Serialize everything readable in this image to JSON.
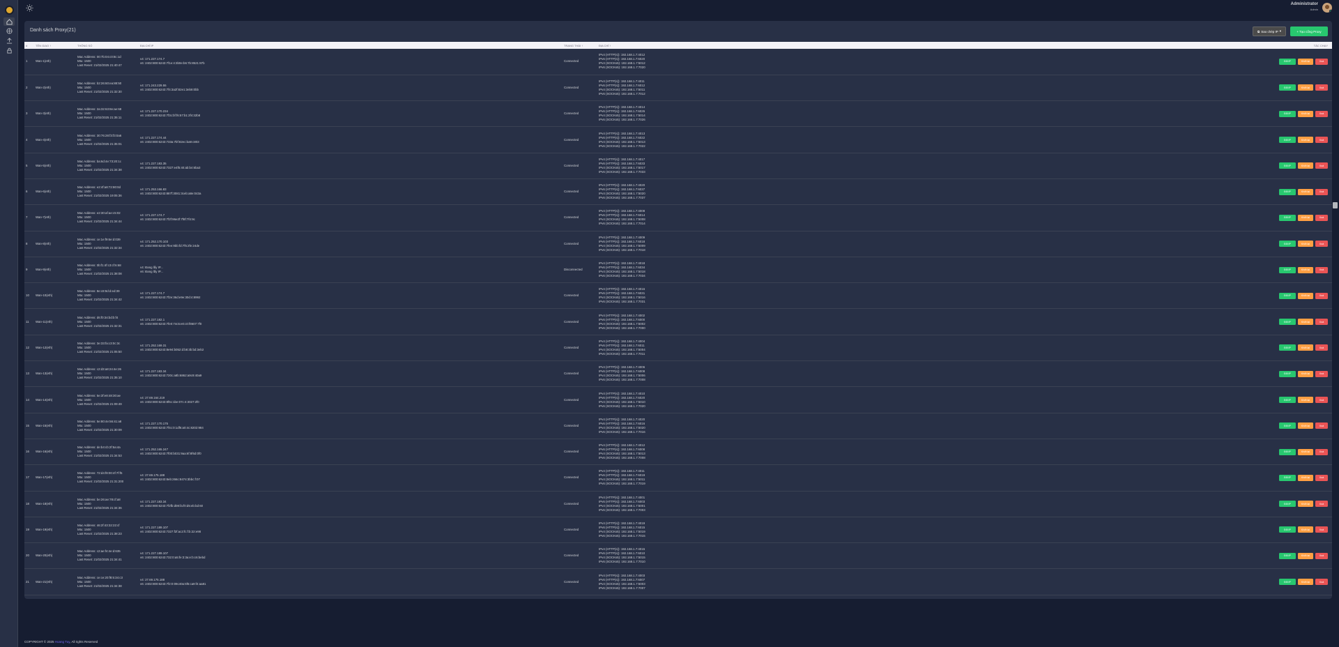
{
  "header": {
    "user_name": "Administrator",
    "user_role": "Admin"
  },
  "sidebar": {
    "items": [
      "home-icon",
      "globe-icon",
      "upload-icon",
      "lock-icon"
    ]
  },
  "card": {
    "title": "Danh sách Proxy(21)",
    "snapshot_label": "Sao chép IP",
    "create_label": "+ Tạo cổng Proxy"
  },
  "table": {
    "headers": [
      "#",
      "TÊN GIAO ↑",
      "THÔNG SỐ",
      "ĐỊA CHỈ IP",
      "TRẠNG THÁI ↑",
      "ĐỊA CHỈ ↑",
      "TÁC CHẠY"
    ],
    "action_labels": {
      "reset": "Đổi IP",
      "restart": "Khởi lại",
      "delete": "Xoá"
    },
    "rows": [
      {
        "no": "1",
        "name": "Wan-1(eth)",
        "mac": "Mac Address: 00:7b:04:c0:8c:1d",
        "mtu": "Mtu: 1500",
        "reset": "Last Reset: 21/02/2025 21:40:47",
        "v4": "v4: 171.227.174.7",
        "v6": "v6: 2402:800:6243:7f1e:4:3b0e:b6:7b:8521:87b",
        "status": "Connected",
        "p1": "IPv4 (HTTP(s)): 192.168.1.7:4012",
        "p2": "IPv6 (HTTP(s)): 192.168.1.7:6020",
        "p3": "IPv4 (SOCKs5): 192.168.1.7:5012",
        "p4": "IPv6 (SOCKs5): 192.168.1.7:7020"
      },
      {
        "no": "2",
        "name": "Wan-2(eth)",
        "mac": "Mac Address: b2:26:60:ea:88:50",
        "mtu": "Mtu: 1500",
        "reset": "Last Reset: 21/02/2025 21:32:30",
        "v4": "v4: 171.243.229.55",
        "v6": "v6: 2402:800:6243:7f4:3a2f:82e1:3eb8:0bb",
        "status": "Connected",
        "p1": "IPv4 (HTTP(s)): 192.168.1.7:4011",
        "p2": "IPv6 (HTTP(s)): 192.168.1.7:6012",
        "p3": "IPv4 (SOCKs5): 192.168.1.7:5011",
        "p4": "IPv6 (SOCKs5): 192.168.1.7:7012"
      },
      {
        "no": "3",
        "name": "Wan-3(eth)",
        "mac": "Mac Address: 2a:32:63:8e:ae:68",
        "mtu": "Mtu: 1500",
        "reset": "Last Reset: 21/02/2025 21:35:11",
        "v4": "v4: 171.227.170.234",
        "v6": "v6: 2402:800:6243:7f3c:bf:f6:57:b1:2f4:32b8",
        "status": "Connected",
        "p1": "IPv4 (HTTP(s)): 192.168.1.7:4014",
        "p2": "IPv6 (HTTP(s)): 192.168.1.7:6026",
        "p3": "IPv4 (SOCKs5): 192.168.1.7:5014",
        "p4": "IPv6 (SOCKs5): 192.168.1.7:7026"
      },
      {
        "no": "4",
        "name": "Wan-4(eth)",
        "mac": "Mac Address: 30:76:28:f3:f3:0a6",
        "mtu": "Mtu: 1500",
        "reset": "Last Reset: 21/02/2025 21:35:01",
        "v4": "v4: 171.227.174.44",
        "v6": "v6: 2402:800:6243:733a:7bf:82ec:ba9:c803",
        "status": "Connected",
        "p1": "IPv4 (HTTP(s)): 192.168.1.7:4013",
        "p2": "IPv6 (HTTP(s)): 192.168.1.7:6022",
        "p3": "IPv4 (SOCKs5): 192.168.1.7:5013",
        "p4": "IPv6 (SOCKs5): 192.168.1.7:7022"
      },
      {
        "no": "5",
        "name": "Wan-5(eth)",
        "mac": "Mac Address: ba:6d:4e:73:20:1c",
        "mtu": "Mtu: 1500",
        "reset": "Last Reset: 21/02/2025 21:34:38",
        "v4": "v4: 171.227.183.35",
        "v6": "v6: 2402:800:6243:7327:e4f5:40:ab:b4:6ba3",
        "status": "Connected",
        "p1": "IPv4 (HTTP(s)): 192.168.1.7:4017",
        "p2": "IPv6 (HTTP(s)): 192.168.1.7:6033",
        "p3": "IPv4 (SOCKs5): 192.168.1.7:5017",
        "p4": "IPv6 (SOCKs5): 192.168.1.7:7033"
      },
      {
        "no": "6",
        "name": "Wan-6(eth)",
        "mac": "Mac Address: e2:4f:a8:72:80:0d",
        "mtu": "Mtu: 1500",
        "reset": "Last Reset: 21/02/2025 19:05:36",
        "v4": "v4: 171.253.166.83",
        "v6": "v6: 2402:800:6243:887f:3081:3ceb:a8e:043a",
        "status": "Connected",
        "p1": "IPv4 (HTTP(s)): 192.168.1.7:4020",
        "p2": "IPv6 (HTTP(s)): 192.168.1.7:6037",
        "p3": "IPv4 (SOCKs5): 192.168.1.7:5020",
        "p4": "IPv6 (SOCKs5): 192.168.1.7:7037"
      },
      {
        "no": "7",
        "name": "Wan-7(eth)",
        "mac": "Mac Address: e2:30:af:ae:c5:02",
        "mtu": "Mtu: 1500",
        "reset": "Last Reset: 21/02/2025 21:34:44",
        "v4": "v4: 171.227.174.7",
        "v6": "v6: 2402:800:6243:7f2f:96e2f:7f8f:7f4:9c",
        "status": "Connected",
        "p1": "IPv4 (HTTP(s)): 192.168.1.7:4008",
        "p2": "IPv6 (HTTP(s)): 192.168.1.7:6014",
        "p3": "IPv4 (SOCKs5): 192.168.1.7:5008",
        "p4": "IPv6 (SOCKs5): 192.168.1.7:7014"
      },
      {
        "no": "8",
        "name": "Wan-8(eth)",
        "mac": "Mac Address: ce:1e:f9:6e:d:039",
        "mtu": "Mtu: 1500",
        "reset": "Last Reset: 21/02/2025 21:32:34",
        "v4": "v4: 171.252.170.103",
        "v6": "v6: 2402:800:6243:7fee:9bb:fd:7f5:2fe:24de",
        "status": "Connected",
        "p1": "IPv4 (HTTP(s)): 192.168.1.7:4009",
        "p2": "IPv6 (HTTP(s)): 192.168.1.7:6018",
        "p3": "IPv4 (SOCKs5): 192.168.1.7:5009",
        "p4": "IPv6 (SOCKs5): 192.168.1.7:7018"
      },
      {
        "no": "9",
        "name": "Wan-9(eth)",
        "mac": "Mac Address: 0b:f1:4f:c3:cf:6:68",
        "mtu": "Mtu: 1500",
        "reset": "Last Reset: 21/02/2025 21:38:08",
        "v4": "v4: Đang lấy IP...",
        "v6": "v6: Đang lấy IP...",
        "status": "Disconnected",
        "p1": "IPv4 (HTTP(s)): 192.168.1.7:4018",
        "p2": "IPv6 (HTTP(s)): 192.168.1.7:6034",
        "p3": "IPv4 (SOCKs5): 192.168.1.7:5018",
        "p4": "IPv6 (SOCKs5): 192.168.1.7:7034"
      },
      {
        "no": "10",
        "name": "Wan-10(eth)",
        "mac": "Mac Address: 8e:c8:9d:d:ed:39",
        "mtu": "Mtu: 1500",
        "reset": "Last Reset: 21/02/2025 21:34:42",
        "v4": "v4: 171.227.174.7",
        "v6": "v6: 2402:800:6243:7f2e:36d:e9e:30d:4:8992",
        "status": "Connected",
        "p1": "IPv4 (HTTP(s)): 192.168.1.7:4016",
        "p2": "IPv6 (HTTP(s)): 192.168.1.7:6031",
        "p3": "IPv4 (SOCKs5): 192.168.1.7:5016",
        "p4": "IPv6 (SOCKs5): 192.168.1.7:7031"
      },
      {
        "no": "11",
        "name": "Wan-11(eth)",
        "mac": "Mac Address: d6:f0:34:bd:b:f4",
        "mtu": "Mtu: 1500",
        "reset": "Last Reset: 21/02/2025 21:32:31",
        "v4": "v4: 171.227.182.1",
        "v6": "v6: 2402:800:6243:7fe0:74c5:e0:c0:f8607:7f0",
        "status": "Connected",
        "p1": "IPv4 (HTTP(s)): 192.168.1.7:4002",
        "p2": "IPv6 (HTTP(s)): 192.168.1.7:6000",
        "p3": "IPv4 (SOCKs5): 192.168.1.7:5002",
        "p4": "IPv6 (SOCKs5): 192.168.1.7:7000"
      },
      {
        "no": "12",
        "name": "Wan-12(eth)",
        "mac": "Mac Address: 3e:33:fa:c3:0c:3c",
        "mtu": "Mtu: 1500",
        "reset": "Last Reset: 21/02/2025 21:05:50",
        "v4": "v4: 171.252.169.31",
        "v6": "v6: 2402:800:6243:8e94:b052:d:b8:3b:bd:3eb2",
        "status": "Connected",
        "p1": "IPv4 (HTTP(s)): 192.168.1.7:4004",
        "p2": "IPv6 (HTTP(s)): 192.168.1.7:6011",
        "p3": "IPv4 (SOCKs5): 192.168.1.7:5004",
        "p4": "IPv6 (SOCKs5): 192.168.1.7:7011"
      },
      {
        "no": "13",
        "name": "Wan-13(eth)",
        "mac": "Mac Address: c2:d3:a8:24:4e:26",
        "mtu": "Mtu: 1500",
        "reset": "Last Reset: 21/02/2025 21:35:10",
        "v4": "v4: 171.227.183.34",
        "v6": "v6: 2402:800:6243:720c:a8b:6862:a9c9:40a9",
        "status": "Connected",
        "p1": "IPv4 (HTTP(s)): 192.168.1.7:4006",
        "p2": "IPv6 (HTTP(s)): 192.168.1.7:6008",
        "p3": "IPv4 (SOCKs5): 192.168.1.7:5006",
        "p4": "IPv6 (SOCKs5): 192.168.1.7:7008"
      },
      {
        "no": "14",
        "name": "Wan-14(eth)",
        "mac": "Mac Address: 5e:3f:e8:48:30:ae",
        "mtu": "Mtu: 1500",
        "reset": "Last Reset: 21/02/2025 21:09:49",
        "v4": "v4: 27.69.164.219",
        "v6": "v6: 2402:800:6243:8f6c:1be:07c:4:3027:2f0",
        "status": "Connected",
        "p1": "IPv4 (HTTP(s)): 192.168.1.7:4010",
        "p2": "IPv6 (HTTP(s)): 192.168.1.7:6020",
        "p3": "IPv4 (SOCKs5): 192.168.1.7:5010",
        "p4": "IPv6 (SOCKs5): 192.168.1.7:7020"
      },
      {
        "no": "15",
        "name": "Wan-15(eth)",
        "mac": "Mac Address: 5e:80:4e:56:41:a8",
        "mtu": "Mtu: 1500",
        "reset": "Last Reset: 21/02/2025 21:30:09",
        "v4": "v4: 171.227.170.175",
        "v6": "v6: 2402:800:6243:7f4c:0:1df6:a0:4c:8202:984",
        "status": "Connected",
        "p1": "IPv4 (HTTP(s)): 192.168.1.7:4020",
        "p2": "IPv6 (HTTP(s)): 192.168.1.7:6016",
        "p3": "IPv4 (SOCKs5): 192.168.1.7:5020",
        "p4": "IPv6 (SOCKs5): 192.168.1.7:7016"
      },
      {
        "no": "16",
        "name": "Wan-16(eth)",
        "mac": "Mac Address: de:b4:cb:2f:5a:4a",
        "mtu": "Mtu: 1500",
        "reset": "Last Reset: 21/02/2025 21:34:53",
        "v4": "v4: 171.252.165.247",
        "v6": "v6: 2402:800:6243:7f00:b031:9aa:6f:8f6d:0f0",
        "status": "Connected",
        "p1": "IPv4 (HTTP(s)): 192.168.1.7:4012",
        "p2": "IPv6 (HTTP(s)): 192.168.1.7:6008",
        "p3": "IPv4 (SOCKs5): 192.168.1.7:5013",
        "p4": "IPv6 (SOCKs5): 192.168.1.7:7008"
      },
      {
        "no": "17",
        "name": "Wan-17(eth)",
        "mac": "Mac Address: 72:d4:f8:00:4f:7f:f5",
        "mtu": "Mtu: 1500",
        "reset": "Last Reset: 21/02/2025 21:31:200",
        "v4": "v4: 27.69.175.188",
        "v6": "v6: 2402:800:6243:8eb:266c:8474:3bbc:f:07",
        "status": "Connected",
        "p1": "IPv4 (HTTP(s)): 192.168.1.7:4011",
        "p2": "IPv6 (HTTP(s)): 192.168.1.7:6019",
        "p3": "IPv4 (SOCKs5): 192.168.1.7:5011",
        "p4": "IPv6 (SOCKs5): 192.168.1.7:7019"
      },
      {
        "no": "18",
        "name": "Wan-18(eth)",
        "mac": "Mac Address: be:26:ae:78:cf:a8",
        "mtu": "Mtu: 1500",
        "reset": "Last Reset: 21/02/2025 21:34:36",
        "v4": "v4: 171.227.183.34",
        "v6": "v6: 2402:800:6243:7f2fb:d08:fa:f0:d5:eb:bd:60",
        "status": "Connected",
        "p1": "IPv4 (HTTP(s)): 192.168.1.7:4001",
        "p2": "IPv6 (HTTP(s)): 192.168.1.7:6003",
        "p3": "IPv4 (SOCKs5): 192.168.1.7:5001",
        "p4": "IPv6 (SOCKs5): 192.168.1.7:7003"
      },
      {
        "no": "19",
        "name": "Wan-19(eth)",
        "mac": "Mac Address: 46:2f:43:32:22:cf",
        "mtu": "Mtu: 1500",
        "reset": "Last Reset: 21/02/2025 21:38:23",
        "v4": "v4: 171.227.189.107",
        "v6": "v6: 2402:800:6243:7327:f2f:ac2:fc:f:b:22:e98",
        "status": "Connected",
        "p1": "IPv4 (HTTP(s)): 192.168.1.7:4019",
        "p2": "IPv6 (HTTP(s)): 192.168.1.7:6015",
        "p3": "IPv4 (SOCKs5): 192.168.1.7:5019",
        "p4": "IPv6 (SOCKs5): 192.168.1.7:7015"
      },
      {
        "no": "20",
        "name": "Wan-20(eth)",
        "mac": "Mac Address: c2:ae:f4:4e:d:635",
        "mtu": "Mtu: 1500",
        "reset": "Last Reset: 21/02/2025 21:34:41",
        "v4": "v4: 171.227.189.107",
        "v6": "v6: 2402:800:6243:732:0:a5:fe:3:3a:e:b:c6:bebd",
        "status": "Connected",
        "p1": "IPv4 (HTTP(s)): 192.168.1.7:4015",
        "p2": "IPv6 (HTTP(s)): 192.168.1.7:6010",
        "p3": "IPv4 (SOCKs5): 192.168.1.7:5015",
        "p4": "IPv6 (SOCKs5): 192.168.1.7:7010"
      },
      {
        "no": "21",
        "name": "Wan-21(eth)",
        "mac": "Mac Address: ce:ce:20:f8:5:34:c3",
        "mtu": "Mtu: 1500",
        "reset": "Last Reset: 21/02/2025 21:34:38",
        "v4": "v4: 27.69.175.188",
        "v6": "v6: 2402:800:6243:7f2:0:09c40a:5f6:ca9:f4:aa81",
        "status": "Connected",
        "p1": "IPv4 (HTTP(s)): 192.168.1.7:4003",
        "p2": "IPv6 (HTTP(s)): 192.168.1.7:6007",
        "p3": "IPv4 (SOCKs5): 192.168.1.7:5003",
        "p4": "IPv6 (SOCKs5): 192.168.1.7:7007"
      }
    ]
  },
  "footer": {
    "prefix": "COPYRIGHT © 2025 ",
    "brand": "Hoang Tuy",
    "suffix": ", All rights Reserved"
  }
}
